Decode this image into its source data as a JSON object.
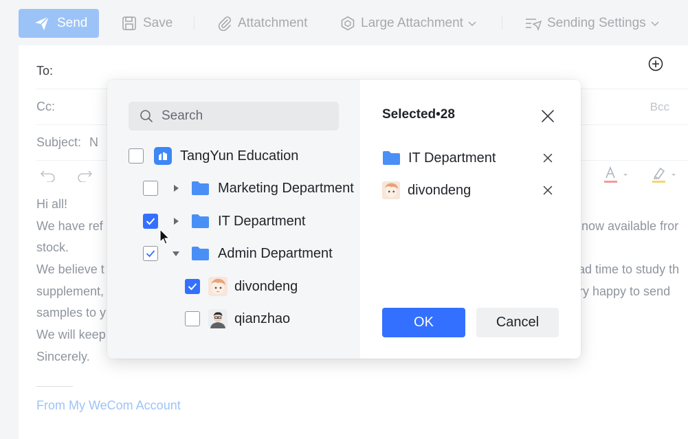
{
  "toolbar": {
    "send_label": "Send",
    "save_label": "Save",
    "attachment_label": "Attatchment",
    "large_attachment_label": "Large Attachment",
    "sending_settings_label": "Sending Settings"
  },
  "compose": {
    "to_label": "To:",
    "cc_label": "Cc:",
    "bcc_label": "Bcc",
    "subject_label": "Subject:",
    "subject_value_visible": "N",
    "body_lines": [
      {
        "left": "Hi all!",
        "right": ""
      },
      {
        "left": "We have ref",
        "right": "now available fror"
      },
      {
        "left": "stock.",
        "right": ""
      },
      {
        "left": "We believe t",
        "right": "ad time to study th"
      },
      {
        "left": "supplement,",
        "right": "ry happy to send"
      },
      {
        "left": "samples to y",
        "right": ""
      },
      {
        "left": "We will keep",
        "right": ""
      },
      {
        "left": "Sincerely.",
        "right": ""
      }
    ],
    "signature_link": "From My WeCom Account"
  },
  "dialog": {
    "search_placeholder": "Search",
    "tree": {
      "org": {
        "label": "TangYun Education",
        "checked": false
      },
      "departments": [
        {
          "label": "Marketing Department",
          "state": "unchecked",
          "expanded": false
        },
        {
          "label": "IT Department",
          "state": "checked",
          "expanded": false
        },
        {
          "label": "Admin Department",
          "state": "partial",
          "expanded": true
        }
      ],
      "members": [
        {
          "label": "divondeng",
          "checked": true
        },
        {
          "label": "qianzhao",
          "checked": false
        }
      ]
    },
    "selected_title": "Selected•28",
    "selected_items": [
      {
        "label": "IT Department",
        "icon": "folder-icon"
      },
      {
        "label": "divondeng",
        "icon": "avatar"
      }
    ],
    "ok_label": "OK",
    "cancel_label": "Cancel"
  },
  "colors": {
    "primary": "#3370ff",
    "send_disabled": "#9cc3f7",
    "folder": "#4a8ff5",
    "link": "#9cc3f7"
  }
}
